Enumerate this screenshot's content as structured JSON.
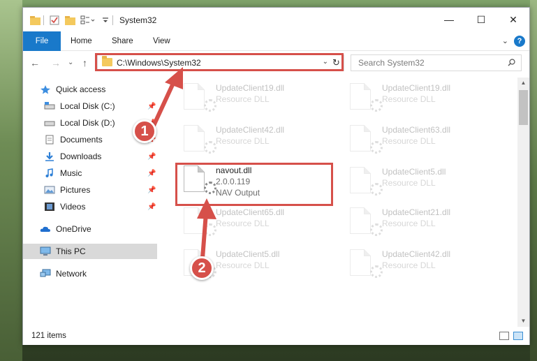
{
  "window": {
    "title": "System32",
    "controls": {
      "minimize": "—",
      "maximize": "☐",
      "close": "✕"
    }
  },
  "ribbon": {
    "tabs": [
      "File",
      "Home",
      "Share",
      "View"
    ],
    "help": "?",
    "collapse": "⌄"
  },
  "navigation": {
    "back": "←",
    "forward": "→",
    "recent": "⌄",
    "up": "↑",
    "address": "C:\\Windows\\System32",
    "dropdown": "⌄",
    "refresh": "↻",
    "search_placeholder": "Search System32"
  },
  "sidebar": {
    "items": [
      {
        "label": "Quick access",
        "icon": "star-icon",
        "pinned": false
      },
      {
        "label": "Local Disk (C:)",
        "icon": "drive-icon",
        "pinned": true
      },
      {
        "label": "Local Disk (D:)",
        "icon": "drive-icon",
        "pinned": true
      },
      {
        "label": "Documents",
        "icon": "documents-icon",
        "pinned": true
      },
      {
        "label": "Downloads",
        "icon": "download-icon",
        "pinned": true
      },
      {
        "label": "Music",
        "icon": "music-icon",
        "pinned": true
      },
      {
        "label": "Pictures",
        "icon": "pictures-icon",
        "pinned": true
      },
      {
        "label": "Videos",
        "icon": "videos-icon",
        "pinned": true
      },
      {
        "label": "OneDrive",
        "icon": "cloud-icon",
        "pinned": false
      },
      {
        "label": "This PC",
        "icon": "computer-icon",
        "pinned": false,
        "selected": true
      },
      {
        "label": "Network",
        "icon": "network-icon",
        "pinned": false
      }
    ]
  },
  "files": [
    {
      "name": "UpdateClient19.dll",
      "type": "Resource DLL",
      "faded": true
    },
    {
      "name": "UpdateClient19.dll",
      "type": "Resource DLL",
      "faded": true
    },
    {
      "name": "UpdateClient42.dll",
      "type": "Resource DLL",
      "faded": true
    },
    {
      "name": "UpdateClient63.dll",
      "type": "Resource DLL",
      "faded": true
    },
    {
      "name": "navout.dll",
      "version": "2.0.0.119",
      "type": "NAV Output",
      "faded": false
    },
    {
      "name": "UpdateClient5.dll",
      "type": "Resource DLL",
      "faded": true
    },
    {
      "name": "UpdateClient65.dll",
      "type": "Resource DLL",
      "faded": true
    },
    {
      "name": "UpdateClient21.dll",
      "type": "Resource DLL",
      "faded": true
    },
    {
      "name": "UpdateClient5.dll",
      "type": "Resource DLL",
      "faded": true
    },
    {
      "name": "UpdateClient42.dll",
      "type": "Resource DLL",
      "faded": true
    }
  ],
  "status": {
    "item_count": "121 items"
  },
  "callouts": {
    "first": "1",
    "second": "2"
  },
  "colors": {
    "accent": "#1979ca",
    "highlight": "#d6504a",
    "selected_bg": "#d9d9d9"
  }
}
